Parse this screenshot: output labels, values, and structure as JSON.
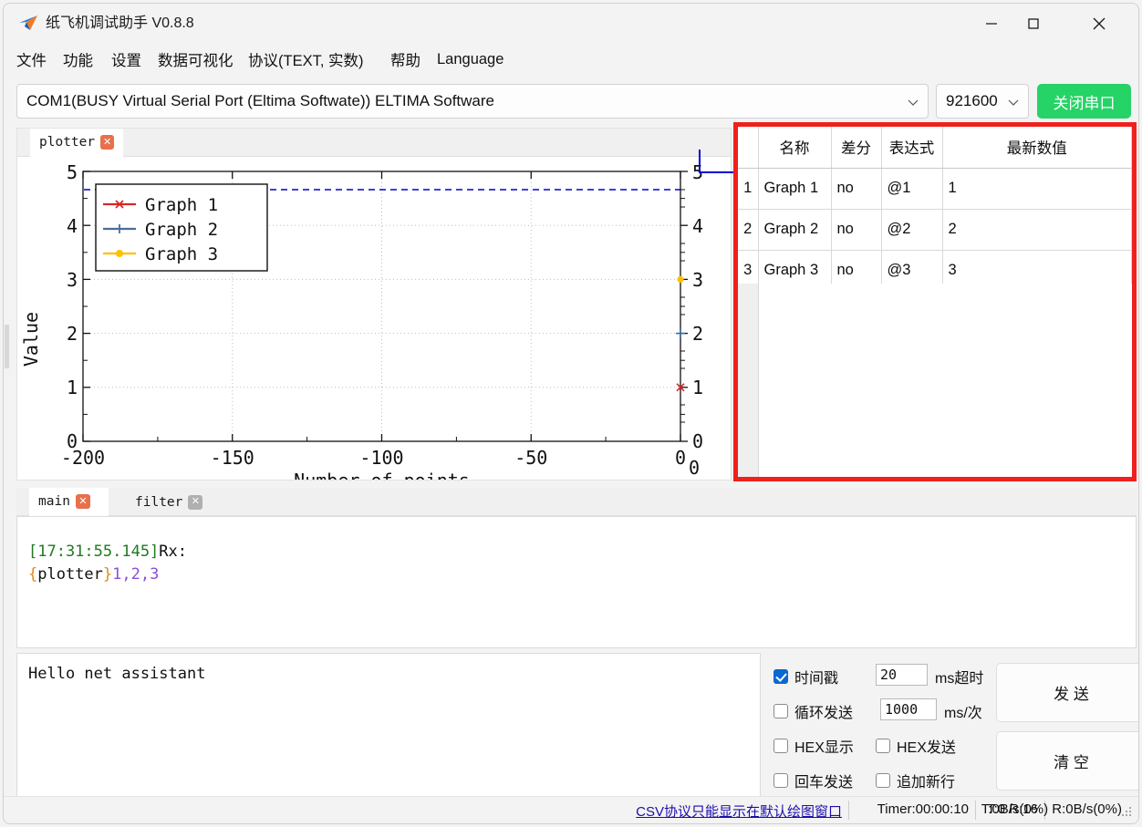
{
  "window": {
    "title": "纸飞机调试助手 V0.8.8",
    "icon": "paper-plane-icon",
    "minimize": "—",
    "maximize": "□",
    "close": "✕"
  },
  "menubar": {
    "items": [
      {
        "label": "文件"
      },
      {
        "label": "功能"
      },
      {
        "label": "设置"
      },
      {
        "label": "数据可视化"
      },
      {
        "label": "协议(TEXT, 实数)"
      },
      {
        "label": "帮助"
      },
      {
        "label": "Language"
      }
    ]
  },
  "connection": {
    "port_value": "COM1(BUSY  Virtual Serial Port (Eltima Softwate)) ELTIMA Software",
    "baud_value": "921600",
    "action_button": "关闭串口",
    "action_color": "#25d366"
  },
  "plot_panel": {
    "tabs": [
      {
        "label": "plotter",
        "close": "✕",
        "active": true
      }
    ]
  },
  "chart_data": {
    "type": "line",
    "title": "",
    "xlabel": "Number of points",
    "ylabel": "Value",
    "xlim": [
      -200,
      0
    ],
    "ylim": [
      0,
      5
    ],
    "xticks": [
      -200,
      -150,
      -100,
      -50,
      0
    ],
    "xticklabels": [
      "-200",
      "-150",
      "-100",
      "-50",
      "0"
    ],
    "yticks": [
      0,
      1,
      2,
      3,
      4,
      5
    ],
    "yticklabels": [
      "0",
      "1",
      "2",
      "3",
      "4",
      "5"
    ],
    "right_axis": {
      "ticks": [
        0,
        1,
        2,
        3,
        4,
        5
      ],
      "ticklabels": [
        "0",
        "1",
        "2",
        "3",
        "4",
        "5"
      ],
      "corner_label": "0"
    },
    "grid": true,
    "legend_position": "upper left",
    "series": [
      {
        "name": "Graph 1",
        "color": "#d62728",
        "marker": "x",
        "x": [
          0
        ],
        "values": [
          1
        ]
      },
      {
        "name": "Graph 2",
        "color": "#4a6e99",
        "marker": "+",
        "x": [
          0
        ],
        "values": [
          2
        ]
      },
      {
        "name": "Graph 3",
        "color": "#ffc000",
        "marker": "o",
        "x": [
          0
        ],
        "values": [
          3
        ]
      }
    ],
    "annotations": [
      {
        "type": "hline",
        "y": 4.66,
        "color": "#0000cc",
        "style": "dashed"
      }
    ]
  },
  "graph_table": {
    "highlight_color": "#f0201c",
    "columns": [
      "",
      "名称",
      "差分",
      "表达式",
      "最新数值"
    ],
    "rows": [
      {
        "index": "1",
        "name": "Graph 1",
        "diff": "no",
        "expr": "@1",
        "latest": "1"
      },
      {
        "index": "2",
        "name": "Graph 2",
        "diff": "no",
        "expr": "@2",
        "latest": "2"
      },
      {
        "index": "3",
        "name": "Graph 3",
        "diff": "no",
        "expr": "@3",
        "latest": "3"
      }
    ]
  },
  "console": {
    "tabs": [
      {
        "label": "main",
        "close": "✕",
        "active": true
      },
      {
        "label": "filter",
        "close": "✕",
        "active": false
      }
    ],
    "lines": [
      {
        "timestamp": "[17:31:55.145]",
        "prefix": "Rx:"
      },
      {
        "open_brace": "{",
        "tag": "plotter",
        "close_brace": "}",
        "payload": "1,2,3"
      }
    ]
  },
  "send": {
    "input_text": "Hello net assistant",
    "options": [
      {
        "label": "时间戳",
        "checked": true
      },
      {
        "label": "循环发送",
        "checked": false
      },
      {
        "label": "HEX显示",
        "checked": false
      },
      {
        "label": "HEX发送",
        "checked": false
      },
      {
        "label": "回车发送",
        "checked": false
      },
      {
        "label": "追加新行",
        "checked": false
      }
    ],
    "timeout_value": "20",
    "timeout_unit": "ms超时",
    "interval_value": "1000",
    "interval_unit": "ms/次",
    "send_button": "发 送",
    "clear_button": "清 空"
  },
  "statusbar": {
    "link": "CSV协议只能显示在默认绘图窗口",
    "timer": "Timer:00:00:10",
    "counts": "T:0 R:16",
    "rates": "T:0B/s(0%) R:0B/s(0%)"
  }
}
